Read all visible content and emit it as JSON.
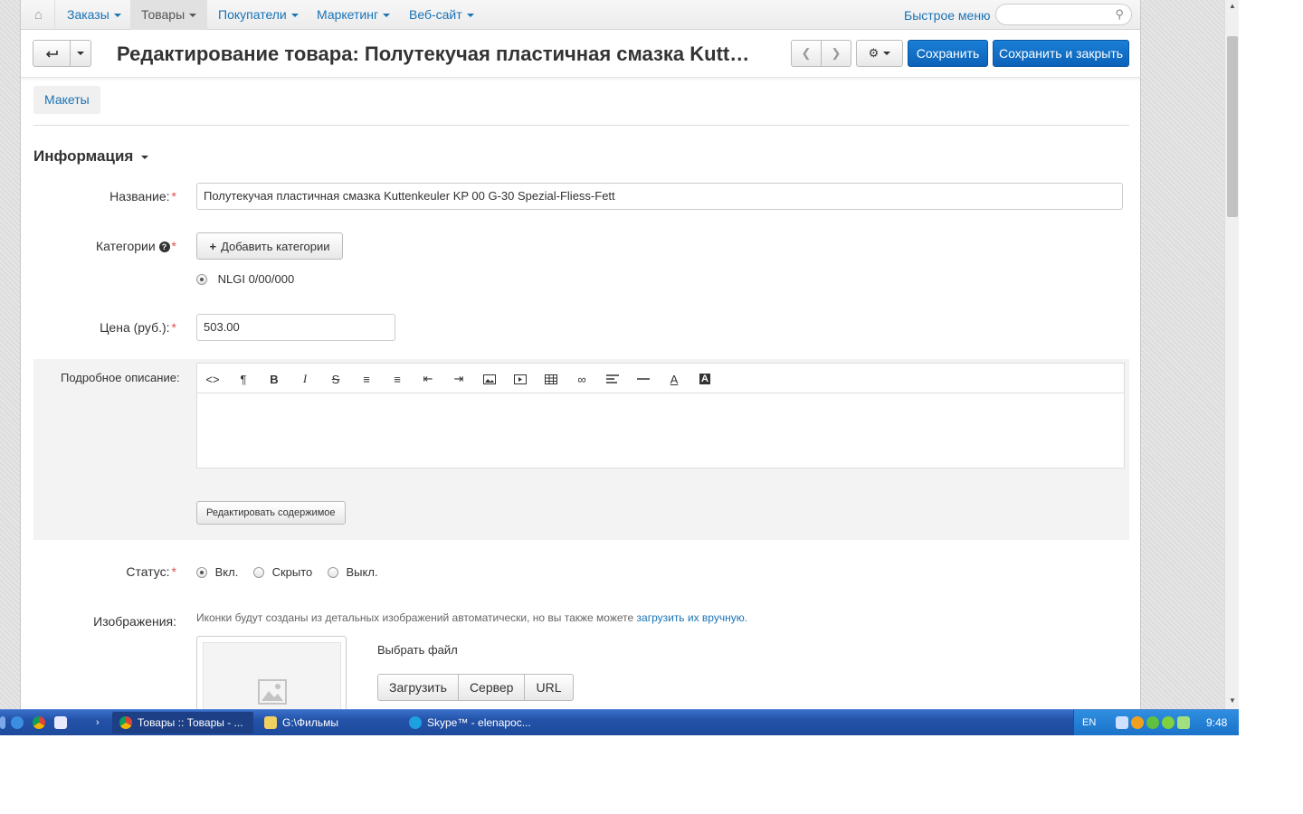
{
  "nav": {
    "items": [
      {
        "label": "Заказы"
      },
      {
        "label": "Товары"
      },
      {
        "label": "Покупатели"
      },
      {
        "label": "Маркетинг"
      },
      {
        "label": "Веб-сайт"
      }
    ],
    "quick_menu": "Быстрое меню",
    "search_value": ""
  },
  "header": {
    "title": "Редактирование товара: Полутекучая пластичная смазка Kutte…",
    "save": "Сохранить",
    "save_close": "Сохранить и закрыть"
  },
  "tabs": {
    "layouts": "Макеты"
  },
  "section": {
    "title": "Информация"
  },
  "form": {
    "name_label": "Название:",
    "name_value": "Полутекучая пластичная смазка Kuttenkeuler KP 00 G-30 Spezial-Fliess-Fett",
    "categories_label": "Категории",
    "add_categories": "Добавить категории",
    "category_option": "NLGI 0/00/000",
    "price_label": "Цена (руб.):",
    "price_value": "503.00",
    "description_label": "Подробное описание:",
    "edit_content": "Редактировать содержимое",
    "status_label": "Статус:",
    "status_options": [
      "Вкл.",
      "Скрыто",
      "Выкл."
    ],
    "status_selected": "Вкл.",
    "images_label": "Изображения:",
    "images_hint": "Иконки будут созданы из детальных изображений автоматически, но вы также можете ",
    "images_hint_link": "загрузить их вручную.",
    "choose_file": "Выбрать файл",
    "upload_buttons": [
      "Загрузить",
      "Сервер",
      "URL"
    ]
  },
  "taskbar": {
    "items": [
      {
        "label": "Товары :: Товары - ..."
      },
      {
        "label": "G:\\Фильмы"
      },
      {
        "label": "Skype™ - elenapoc..."
      }
    ],
    "lang": "EN",
    "clock": "9:48"
  },
  "colors": {
    "accent": "#1a73b5",
    "primary_button": "#0b62b8",
    "required": "#d9534f",
    "taskbar": "#2352a8"
  }
}
